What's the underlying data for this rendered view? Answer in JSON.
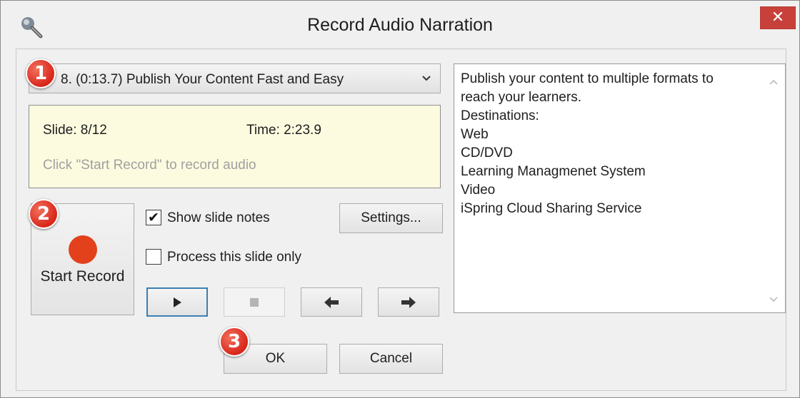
{
  "window": {
    "title": "Record Audio Narration",
    "close_glyph": "✕"
  },
  "slide_selector": {
    "selected": "8. (0:13.7) Publish Your Content Fast and Easy"
  },
  "info": {
    "slide": "Slide: 8/12",
    "time": "Time: 2:23.9",
    "hint": "Click \"Start Record\" to record audio"
  },
  "record": {
    "label": "Start Record",
    "dot_color": "#e2411c"
  },
  "options": {
    "show_notes": {
      "label": "Show slide notes",
      "checked": true,
      "mark": "✔"
    },
    "process_only": {
      "label": "Process this slide only",
      "checked": false
    }
  },
  "settings": {
    "label": "Settings..."
  },
  "playback": {
    "play_icon": "play-icon",
    "stop_icon": "stop-icon",
    "prev_icon": "arrow-left-icon",
    "next_icon": "arrow-right-icon"
  },
  "notes": {
    "lines": [
      "Publish your content to multiple formats to",
      "reach your learners.",
      "Destinations:",
      "Web",
      "CD/DVD",
      "Learning Managmenet System",
      "Video",
      "iSpring Cloud Sharing Service"
    ]
  },
  "footer": {
    "ok": "OK",
    "cancel": "Cancel"
  },
  "badges": [
    "1",
    "2",
    "3"
  ],
  "colors": {
    "close": "#c7413a",
    "badge": "#d8261a",
    "info_bg": "#fdfbdf",
    "focus": "#3c7fb1"
  }
}
